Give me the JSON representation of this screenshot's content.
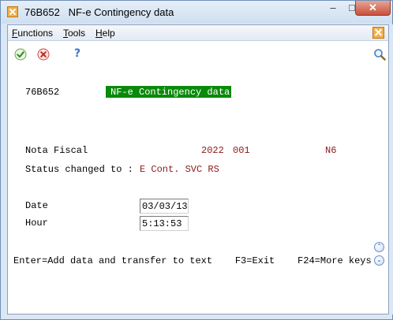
{
  "window": {
    "title": "76B652   NF-e Contingency data",
    "minimize_glyph": "–",
    "maximize_glyph": "□",
    "close_glyph": "✕"
  },
  "menu": {
    "functions": {
      "mnemonic": "F",
      "rest": "unctions"
    },
    "tools": {
      "mnemonic": "T",
      "rest": "ools"
    },
    "help": {
      "mnemonic": "H",
      "rest": "elp"
    }
  },
  "toolbar": {
    "ok_icon": "green-check-icon",
    "cancel_icon": "red-x-icon",
    "help_glyph": "?",
    "search_icon": "magnifier-icon"
  },
  "screen": {
    "program_id": "76B652",
    "title": "NF-e Contingency data",
    "nota_fiscal": {
      "label": "Nota Fiscal",
      "year": "2022",
      "series": "001",
      "code": "N6"
    },
    "status": {
      "label": "Status changed to :",
      "value": "E Cont. SVC RS"
    },
    "date": {
      "label": "Date",
      "value": "03/03/13"
    },
    "hour": {
      "label": "Hour",
      "value": "5:13:53"
    },
    "function_keys": "Enter=Add data and transfer to text    F3=Exit    F24=More keys"
  },
  "colors": {
    "title_bg": "#0a8a0a",
    "value_text": "#8b1a1a",
    "frame": "#dbe7f4"
  }
}
